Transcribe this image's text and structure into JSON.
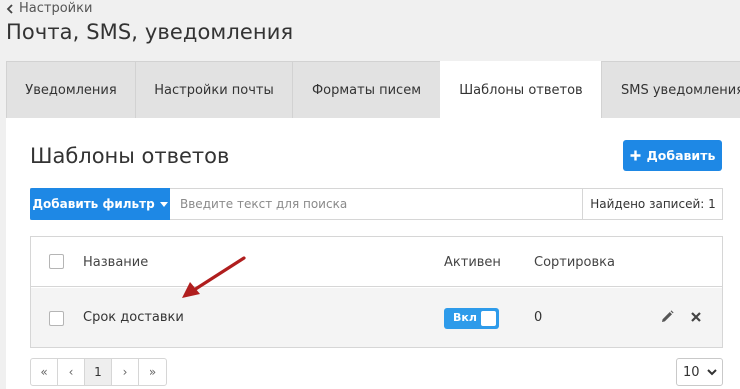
{
  "header": {
    "breadcrumb": "Настройки",
    "title": "Почта, SMS, уведомления"
  },
  "tabs": [
    {
      "label": "Уведомления",
      "active": false
    },
    {
      "label": "Настройки почты",
      "active": false
    },
    {
      "label": "Форматы писем",
      "active": false
    },
    {
      "label": "Шаблоны ответов",
      "active": true
    },
    {
      "label": "SMS уведомления",
      "active": false
    }
  ],
  "section": {
    "title": "Шаблоны ответов",
    "add_label": "Добавить"
  },
  "filter": {
    "button_label": "Добавить фильтр",
    "search_placeholder": "Введите текст для поиска",
    "search_value": "",
    "found_text": "Найдено записей: 1"
  },
  "table": {
    "headers": {
      "name": "Название",
      "active": "Активен",
      "sort": "Сортировка"
    },
    "rows": [
      {
        "name": "Срок доставки",
        "toggle_label": "Вкл",
        "active": true,
        "sort": "0"
      }
    ]
  },
  "pagination": {
    "first": "«",
    "prev": "‹",
    "current": "1",
    "next": "›",
    "last": "»",
    "per_page": "10"
  },
  "icons": {
    "back": "chevron-left-icon",
    "add": "plus-icon",
    "filter_caret": "caret-down-icon",
    "edit": "pencil-icon",
    "delete": "close-icon",
    "annotation": "red-arrow-icon"
  },
  "colors": {
    "accent": "#1e88e5",
    "toggle": "#2e9bea",
    "annotation_arrow": "#b01e1e"
  }
}
